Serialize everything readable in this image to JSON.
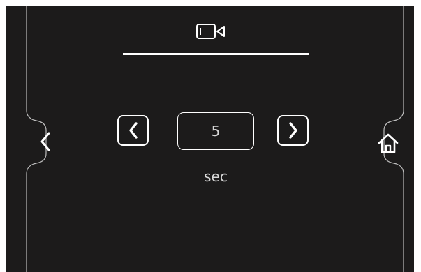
{
  "header": {
    "icon": "video-camera-icon"
  },
  "navigation": {
    "back_icon": "chevron-left-icon",
    "home_icon": "home-icon"
  },
  "timer": {
    "value": "5",
    "unit": "sec",
    "decrease_icon": "chevron-left-icon",
    "increase_icon": "chevron-right-icon"
  },
  "colors": {
    "background": "#1c1b1b",
    "foreground": "#ffffff",
    "text": "#d8d8d8"
  }
}
